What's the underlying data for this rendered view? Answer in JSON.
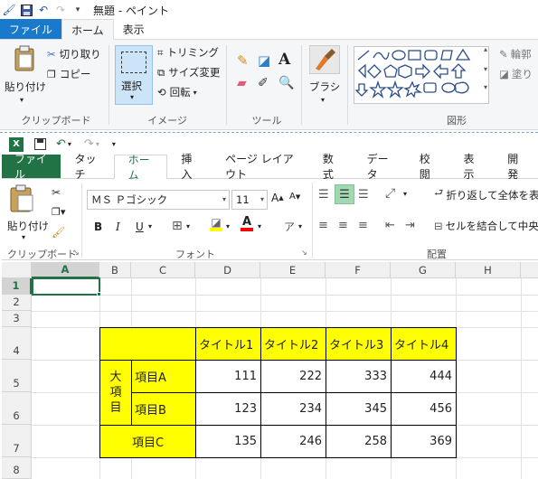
{
  "paint": {
    "title": "無題 - ペイント",
    "tabs": [
      {
        "label": "ファイル"
      },
      {
        "label": "ホーム"
      },
      {
        "label": "表示"
      }
    ],
    "clipboard": {
      "paste": "貼り付け",
      "cut": "切り取り",
      "copy": "コピー",
      "group": "クリップボード"
    },
    "image": {
      "select": "選択",
      "crop": "トリミング",
      "resize": "サイズ変更",
      "rotate": "回転",
      "group": "イメージ"
    },
    "tools": {
      "group": "ツール"
    },
    "brushes": {
      "label": "ブラシ"
    },
    "shapes": {
      "group": "図形",
      "outline": "輪郭",
      "fill": "塗り"
    }
  },
  "excel": {
    "tabs": [
      {
        "label": "ファイル"
      },
      {
        "label": "タッチ"
      },
      {
        "label": "ホーム"
      },
      {
        "label": "挿入"
      },
      {
        "label": "ページ レイアウト"
      },
      {
        "label": "数式"
      },
      {
        "label": "データ"
      },
      {
        "label": "校閲"
      },
      {
        "label": "表示"
      },
      {
        "label": "開発"
      }
    ],
    "font_name": "ＭＳ Ｐゴシック",
    "font_size": "11",
    "clipboard": {
      "paste": "貼り付け",
      "group": "クリップボード"
    },
    "font_group": "フォント",
    "align_group": "配置",
    "wrap_text": "折り返して全体を表",
    "merge_center": "セルを結合して中央",
    "bold": "B",
    "italic": "I",
    "underline": "U",
    "columns": [
      "A",
      "B",
      "C",
      "D",
      "E",
      "F",
      "G",
      "H"
    ],
    "rows": [
      "1",
      "2",
      "3",
      "4",
      "5",
      "6",
      "7",
      "8"
    ],
    "table": {
      "headers": [
        "タイトル1",
        "タイトル2",
        "タイトル3",
        "タイトル4"
      ],
      "big_item": [
        "大",
        "項",
        "目"
      ],
      "item_a": "項目A",
      "item_b": "項目B",
      "item_c": "項目C",
      "row_a": [
        "111",
        "222",
        "333",
        "444"
      ],
      "row_b": [
        "123",
        "234",
        "345",
        "456"
      ],
      "row_c": [
        "135",
        "246",
        "258",
        "369"
      ]
    }
  }
}
